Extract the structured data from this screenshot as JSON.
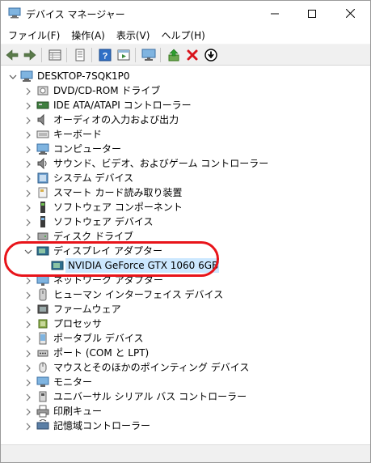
{
  "window": {
    "title": "デバイス マネージャー"
  },
  "menu": [
    {
      "label": "ファイル(F)"
    },
    {
      "label": "操作(A)"
    },
    {
      "label": "表示(V)"
    },
    {
      "label": "ヘルプ(H)"
    }
  ],
  "toolbar": {
    "buttons": [
      {
        "icon": "back-arrow-icon"
      },
      {
        "icon": "forward-arrow-icon"
      },
      {
        "icon": "properties-grid-icon"
      },
      {
        "icon": "document-icon"
      },
      {
        "icon": "help-icon"
      },
      {
        "icon": "run-icon"
      },
      {
        "icon": "monitor-icon"
      },
      {
        "icon": "update-driver-icon"
      },
      {
        "icon": "delete-x-icon"
      },
      {
        "icon": "download-icon"
      }
    ]
  },
  "tree": {
    "root": {
      "label": "DESKTOP-7SQK1P0"
    },
    "items": [
      {
        "label": "DVD/CD-ROM ドライブ",
        "icon": "dvd-drive-icon"
      },
      {
        "label": "IDE ATA/ATAPI コントローラー",
        "icon": "ide-controller-icon"
      },
      {
        "label": "オーディオの入力および出力",
        "icon": "speaker-icon"
      },
      {
        "label": "キーボード",
        "icon": "keyboard-icon"
      },
      {
        "label": "コンピューター",
        "icon": "computer-icon"
      },
      {
        "label": "サウンド、ビデオ、およびゲーム コントローラー",
        "icon": "sound-icon"
      },
      {
        "label": "システム デバイス",
        "icon": "system-device-icon"
      },
      {
        "label": "スマート カード読み取り装置",
        "icon": "smart-card-icon"
      },
      {
        "label": "ソフトウェア コンポーネント",
        "icon": "software-component-icon"
      },
      {
        "label": "ソフトウェア デバイス",
        "icon": "software-device-icon"
      },
      {
        "label": "ディスク ドライブ",
        "icon": "disk-drive-icon"
      },
      {
        "label": "ディスプレイ アダプター",
        "icon": "display-adapter-icon",
        "expanded": true
      },
      {
        "label": "NVIDIA GeForce GTX 1060 6GB",
        "icon": "display-adapter-icon",
        "child": true,
        "selected": true
      },
      {
        "label": "ネットワーク アダプター",
        "icon": "network-adapter-icon"
      },
      {
        "label": "ヒューマン インターフェイス デバイス",
        "icon": "hid-icon"
      },
      {
        "label": "ファームウェア",
        "icon": "firmware-icon"
      },
      {
        "label": "プロセッサ",
        "icon": "processor-icon"
      },
      {
        "label": "ポータブル デバイス",
        "icon": "portable-device-icon"
      },
      {
        "label": "ポート (COM と LPT)",
        "icon": "port-icon"
      },
      {
        "label": "マウスとそのほかのポインティング デバイス",
        "icon": "mouse-icon"
      },
      {
        "label": "モニター",
        "icon": "monitor-icon"
      },
      {
        "label": "ユニバーサル シリアル バス コントローラー",
        "icon": "usb-icon"
      },
      {
        "label": "印刷キュー",
        "icon": "printer-icon"
      },
      {
        "label": "記憶域コントローラー",
        "icon": "storage-controller-icon"
      }
    ]
  },
  "colors": {
    "selection": "#cce8ff",
    "annotation": "#e8141a",
    "toolbar_bg": "#f0f0f0"
  }
}
